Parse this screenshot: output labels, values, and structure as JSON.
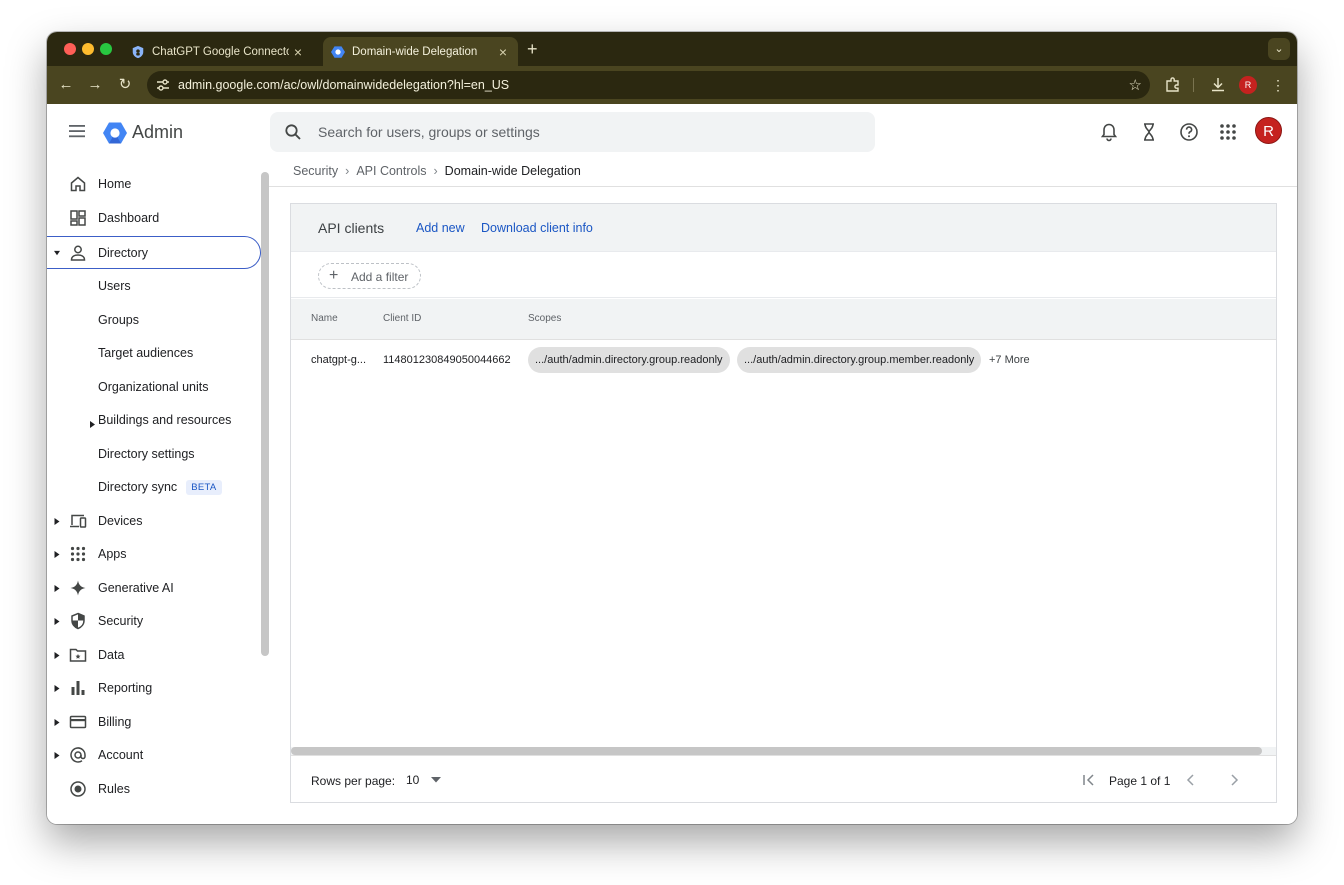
{
  "browser": {
    "tabs": [
      {
        "title": "ChatGPT Google Connector -",
        "close": "×",
        "favicon": "shield-icon"
      },
      {
        "title": "Domain-wide Delegation",
        "close": "×",
        "favicon": "admin-logo-icon"
      }
    ],
    "new_tab": "+",
    "url_host": "admin.google.com",
    "url_path": "/ac/owl/domainwidedelegation?hl=en_US",
    "profile_initial": "R",
    "colors": {
      "frame": "#2b2810",
      "toolbar": "#4a4520"
    }
  },
  "app": {
    "brand": "Admin",
    "search_placeholder": "Search for users, groups or settings",
    "avatar_initial": "R",
    "accent": "#1a56c4",
    "avatar_color": "#c5221f"
  },
  "sidebar": {
    "home": "Home",
    "dashboard": "Dashboard",
    "directory": "Directory",
    "directory_children": {
      "users": "Users",
      "groups": "Groups",
      "target_audiences": "Target audiences",
      "org_units": "Organizational units",
      "buildings": "Buildings and resources",
      "directory_settings": "Directory settings",
      "directory_sync": "Directory sync",
      "beta": "BETA"
    },
    "devices": "Devices",
    "apps": "Apps",
    "generative_ai": "Generative AI",
    "security": "Security",
    "data": "Data",
    "reporting": "Reporting",
    "billing": "Billing",
    "account": "Account",
    "rules": "Rules"
  },
  "breadcrumb": {
    "items": [
      "Security",
      "API Controls"
    ],
    "current": "Domain-wide Delegation",
    "separator": "›"
  },
  "card": {
    "title": "API clients",
    "add_new": "Add new",
    "download": "Download client info",
    "add_filter": "Add a filter",
    "columns": {
      "name": "Name",
      "client_id": "Client ID",
      "scopes": "Scopes"
    },
    "rows": [
      {
        "name": "chatgpt-g...",
        "client_id": "114801230849050044662",
        "scopes": [
          ".../auth/admin.directory.group.readonly",
          ".../auth/admin.directory.group.member.readonly"
        ],
        "more": "+7 More"
      }
    ],
    "footer": {
      "rows_per_page_label": "Rows per page:",
      "rows_per_page": "10",
      "page_label": "Page 1 of 1"
    }
  }
}
